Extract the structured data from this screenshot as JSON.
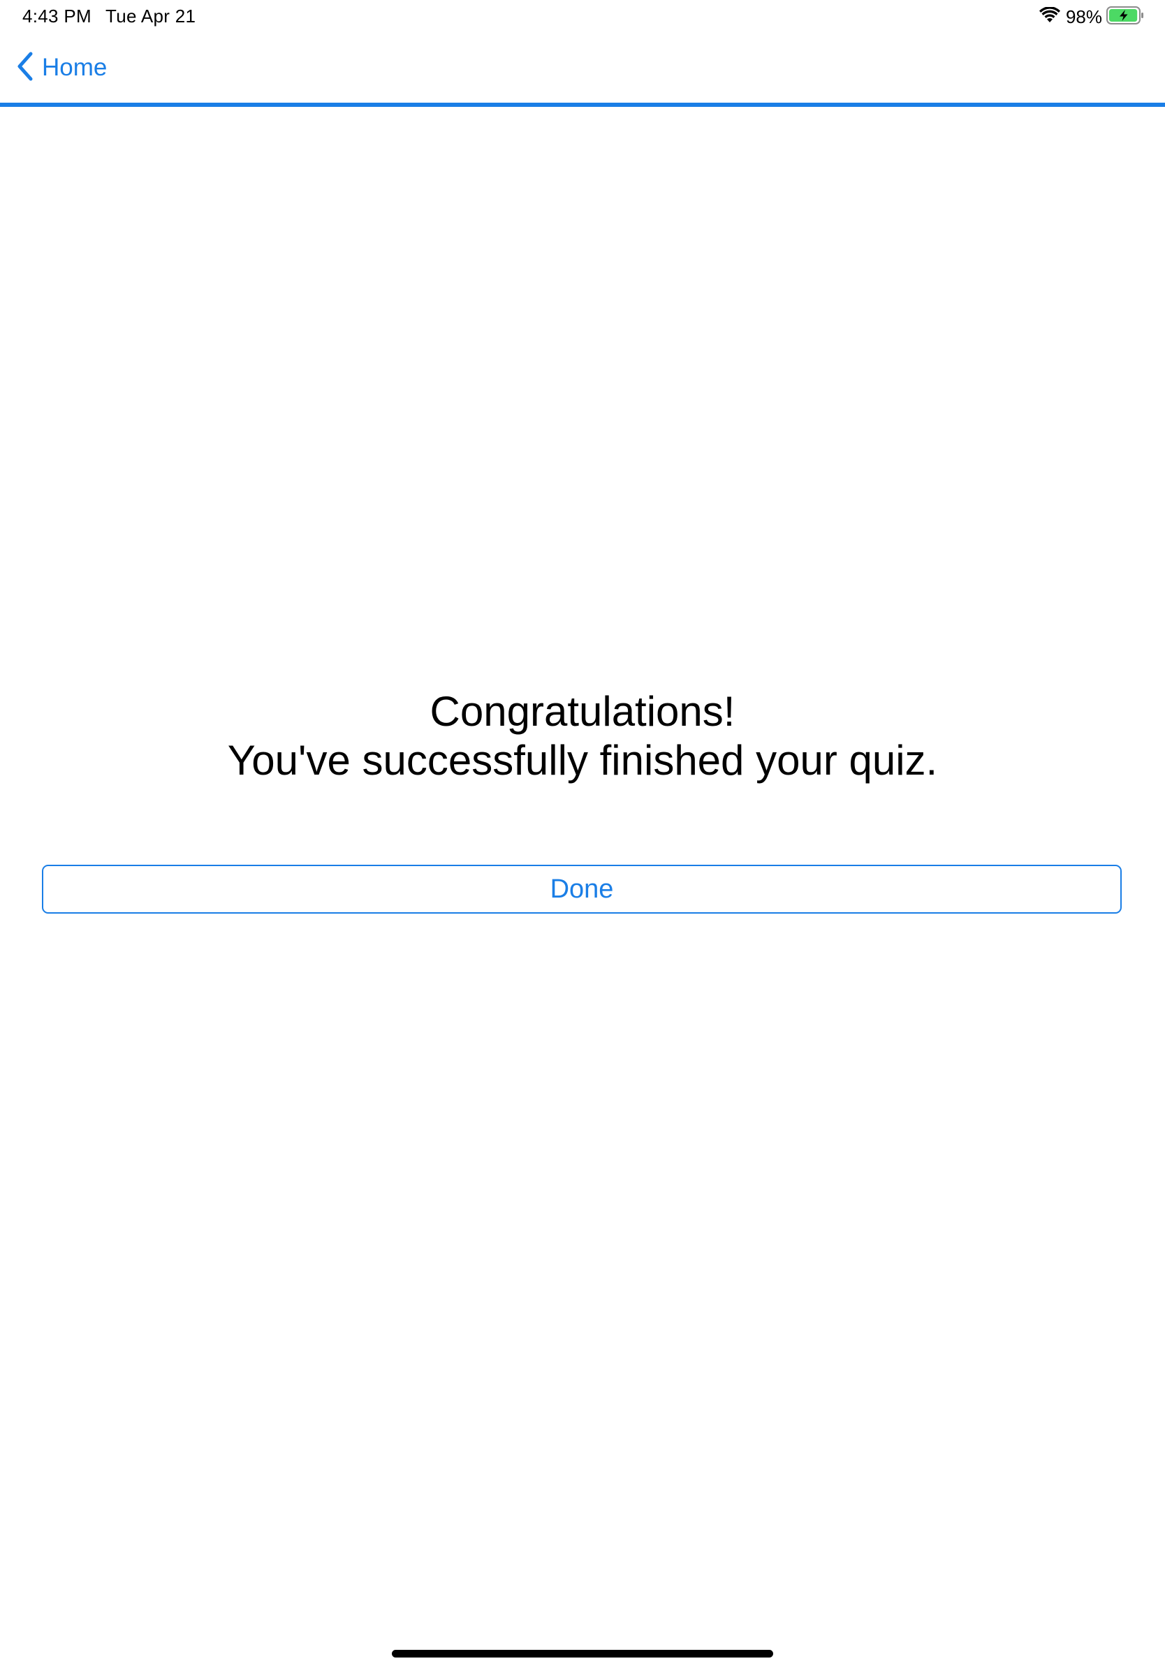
{
  "status_bar": {
    "time": "4:43 PM",
    "date": "Tue Apr 21",
    "battery_percent": "98%",
    "battery_level": 0.98,
    "charging": true,
    "wifi_icon": "wifi-icon",
    "battery_icon": "battery-charging-icon"
  },
  "nav": {
    "back_label": "Home",
    "back_icon": "chevron-left-icon"
  },
  "main": {
    "line1": "Congratulations!",
    "line2": "You've successfully finished your quiz.",
    "done_label": "Done"
  },
  "colors": {
    "accent": "#1a7ee6",
    "battery_fill": "#4cd964",
    "text": "#000000",
    "background": "#ffffff"
  }
}
